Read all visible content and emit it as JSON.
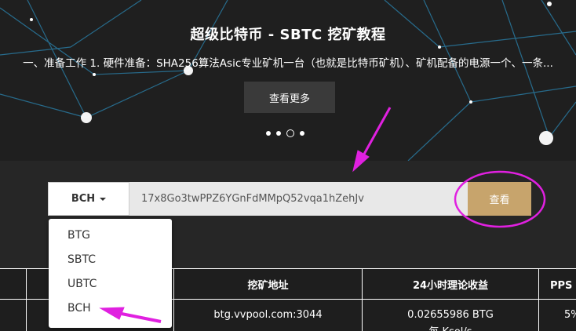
{
  "hero": {
    "title": "超级比特币 - SBTC 挖矿教程",
    "subtitle": "一、准备工作 1. 硬件准备：SHA256算法Asic专业矿机一台（也就是比特币矿机）、矿机配备的电源一个、一条...",
    "more_button": "查看更多",
    "carousel_dots": 4,
    "active_dot": 3
  },
  "search": {
    "selected_coin": "BCH",
    "address_value": "17x8Go3twPPZ6YGnFdMMpQ52vqa1hZehJv",
    "view_button": "查看"
  },
  "dropdown": {
    "options": [
      "BTG",
      "SBTC",
      "UBTC",
      "BCH"
    ]
  },
  "table": {
    "headers": [
      "",
      "",
      "挖矿地址",
      "24小时理论收益",
      "PPS 费率"
    ],
    "row": [
      "",
      "",
      "btg.vvpool.com:3044",
      "0.02655986 BTG",
      "5%"
    ],
    "row_extra": "每 Ksol/s"
  },
  "colors": {
    "accent": "#c7a46c",
    "annotation": "#e020e0",
    "background": "#262626"
  }
}
